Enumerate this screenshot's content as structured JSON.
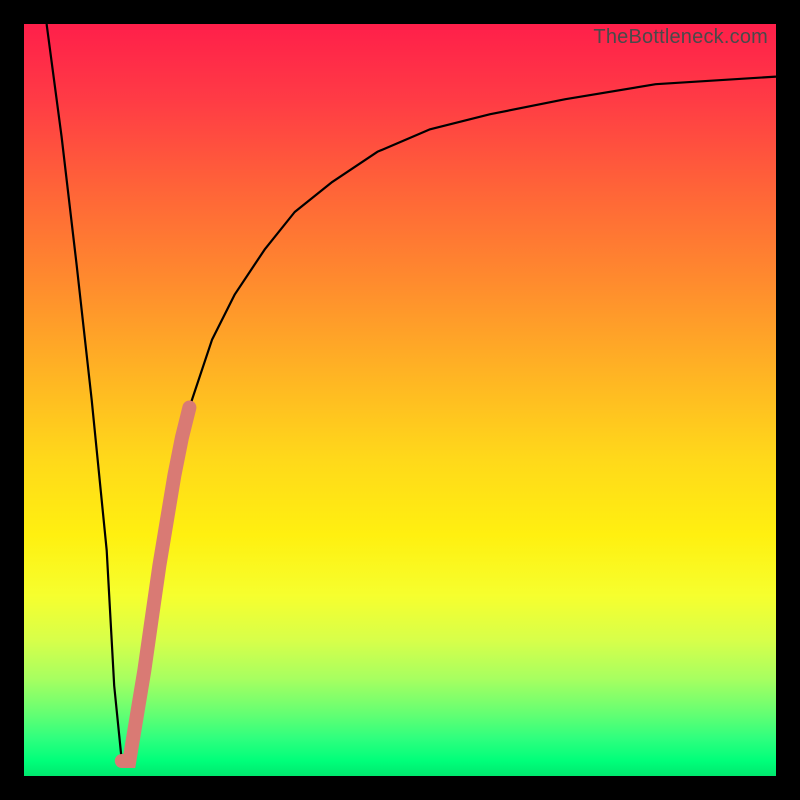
{
  "watermark": {
    "text": "TheBottleneck.com"
  },
  "colors": {
    "frame": "#000000",
    "curve": "#000000",
    "marker": "#d97a74",
    "gradient_top": "#ff1f4a",
    "gradient_bottom": "#00e86e"
  },
  "chart_data": {
    "type": "line",
    "title": "",
    "xlabel": "",
    "ylabel": "",
    "xlim": [
      0,
      100
    ],
    "ylim": [
      0,
      100
    ],
    "gradient_stops": [
      {
        "pos": 0,
        "color": "#ff1f4a"
      },
      {
        "pos": 10,
        "color": "#ff3b45"
      },
      {
        "pos": 22,
        "color": "#ff6438"
      },
      {
        "pos": 34,
        "color": "#ff8a2e"
      },
      {
        "pos": 46,
        "color": "#ffb224"
      },
      {
        "pos": 58,
        "color": "#ffd91a"
      },
      {
        "pos": 68,
        "color": "#fff010"
      },
      {
        "pos": 76,
        "color": "#f6ff2e"
      },
      {
        "pos": 82,
        "color": "#d7ff4a"
      },
      {
        "pos": 87,
        "color": "#a8ff60"
      },
      {
        "pos": 91,
        "color": "#6fff70"
      },
      {
        "pos": 95,
        "color": "#2fff7e"
      },
      {
        "pos": 98,
        "color": "#00ff7a"
      },
      {
        "pos": 100,
        "color": "#00e86e"
      }
    ],
    "series": [
      {
        "name": "bottleneck-curve",
        "x": [
          3,
          5,
          7,
          9,
          11,
          12,
          13,
          14,
          16,
          18,
          20,
          22,
          25,
          28,
          32,
          36,
          41,
          47,
          54,
          62,
          72,
          84,
          100
        ],
        "y": [
          100,
          85,
          68,
          50,
          30,
          12,
          2,
          2,
          14,
          28,
          40,
          49,
          58,
          64,
          70,
          75,
          79,
          83,
          86,
          88,
          90,
          92,
          93
        ]
      }
    ],
    "highlight_segment": {
      "name": "highlight-marker",
      "x": [
        13,
        14,
        15,
        16,
        17,
        18,
        19,
        20,
        21,
        22
      ],
      "y": [
        2,
        2,
        8,
        14,
        21,
        28,
        34,
        40,
        45,
        49
      ]
    },
    "minimum_point": {
      "x": 13.5,
      "y": 2
    }
  }
}
